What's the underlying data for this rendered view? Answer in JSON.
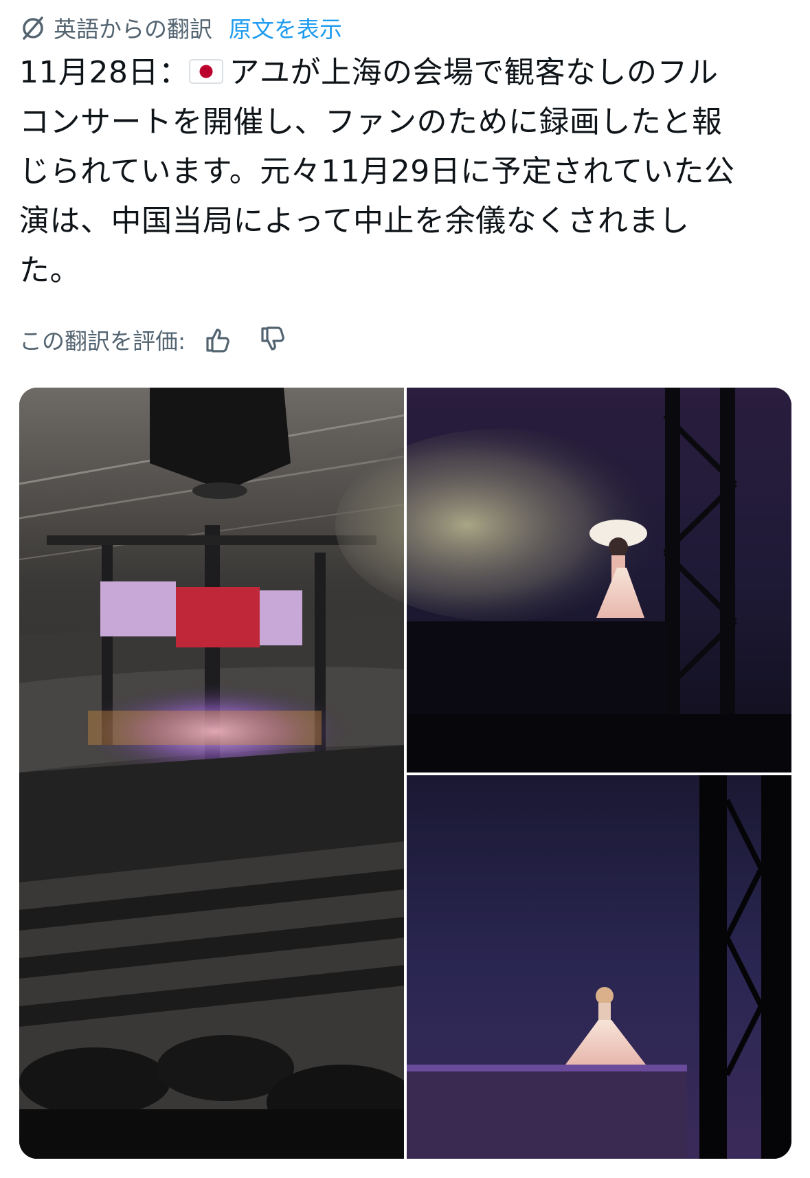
{
  "translation": {
    "from_label": "英語からの翻訳",
    "show_original": "原文を表示"
  },
  "post": {
    "lines": [
      "11月28日：",
      "アユが上海の会場で観客なしのフル",
      "コンサートを開催し、ファンのために録画したと報",
      "じられています。元々11月29日に予定されていた公",
      "演は、中国当局によって中止を余儀なくされまし",
      "た。"
    ],
    "flag_emoji": "🇯🇵"
  },
  "rating": {
    "label": "この翻訳を評価:",
    "up_icon": "thumbs-up-icon",
    "down_icon": "thumbs-down-icon"
  },
  "media": {
    "count": 3,
    "colors": {
      "arena_dark": "#1a1a1c",
      "stage_purple": "#6a4a9a",
      "screen_red": "#c0283a",
      "night_blue": "#14122e",
      "dress_pink": "#f2d2c8"
    }
  }
}
